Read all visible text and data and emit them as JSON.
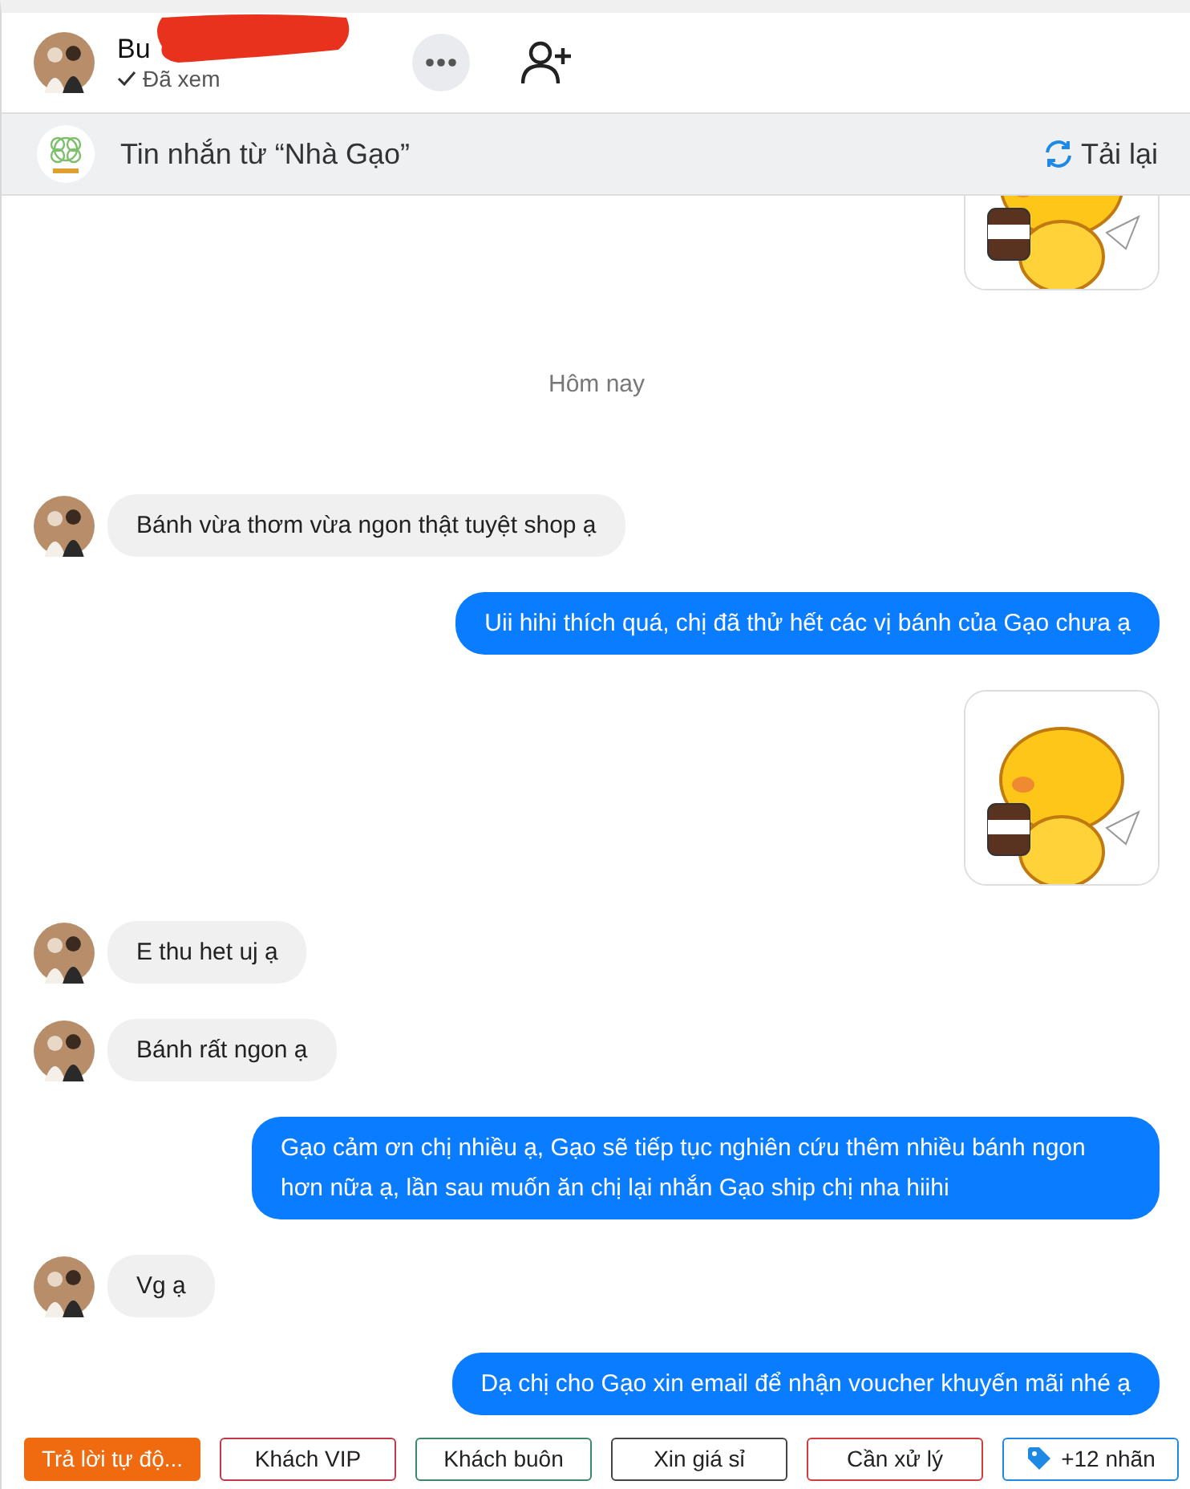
{
  "header": {
    "name": "Bu",
    "status": "Đã xem"
  },
  "banner": {
    "text": "Tin nhắn từ  “Nhà Gạo”",
    "reload": "Tải lại"
  },
  "messages": [
    {
      "kind": "sticker",
      "outgoing": true
    },
    {
      "kind": "date",
      "text": "Hôm nay"
    },
    {
      "kind": "text",
      "outgoing": false,
      "text": "Bánh vừa thơm vừa ngon thật tuyệt shop ạ"
    },
    {
      "kind": "text",
      "outgoing": true,
      "text": "Uii hihi thích quá, chị đã thử hết các vị bánh của Gạo chưa ạ"
    },
    {
      "kind": "sticker",
      "outgoing": true
    },
    {
      "kind": "text",
      "outgoing": false,
      "text": "E thu het uj ạ"
    },
    {
      "kind": "text",
      "outgoing": false,
      "text": "Bánh rất ngon ạ"
    },
    {
      "kind": "text",
      "outgoing": true,
      "text": "Gạo cảm ơn chị nhiều ạ, Gạo sẽ tiếp tục nghiên cứu thêm nhiều bánh ngon hơn nữa ạ, lần sau muốn ăn chị lại nhắn Gạo ship chị nha hiihi"
    },
    {
      "kind": "text",
      "outgoing": false,
      "text": "Vg ạ"
    },
    {
      "kind": "text",
      "outgoing": true,
      "text": "Dạ chị cho Gạo xin email để nhận voucher khuyến mãi nhé ạ"
    }
  ],
  "tags": [
    {
      "kind": "auto",
      "label": "Trả lời tự độ...",
      "color": "#f06a0f"
    },
    {
      "kind": "tag",
      "label": "Khách VIP",
      "color": "#c0394b"
    },
    {
      "kind": "tag",
      "label": "Khách buôn",
      "color": "#3a8a6a"
    },
    {
      "kind": "tag",
      "label": "Xin giá sỉ",
      "color": "#444444"
    },
    {
      "kind": "tag",
      "label": "Cần xử lý",
      "color": "#d23c3c"
    },
    {
      "kind": "more",
      "label": "+12 nhãn",
      "color": "#1e88e5"
    }
  ]
}
